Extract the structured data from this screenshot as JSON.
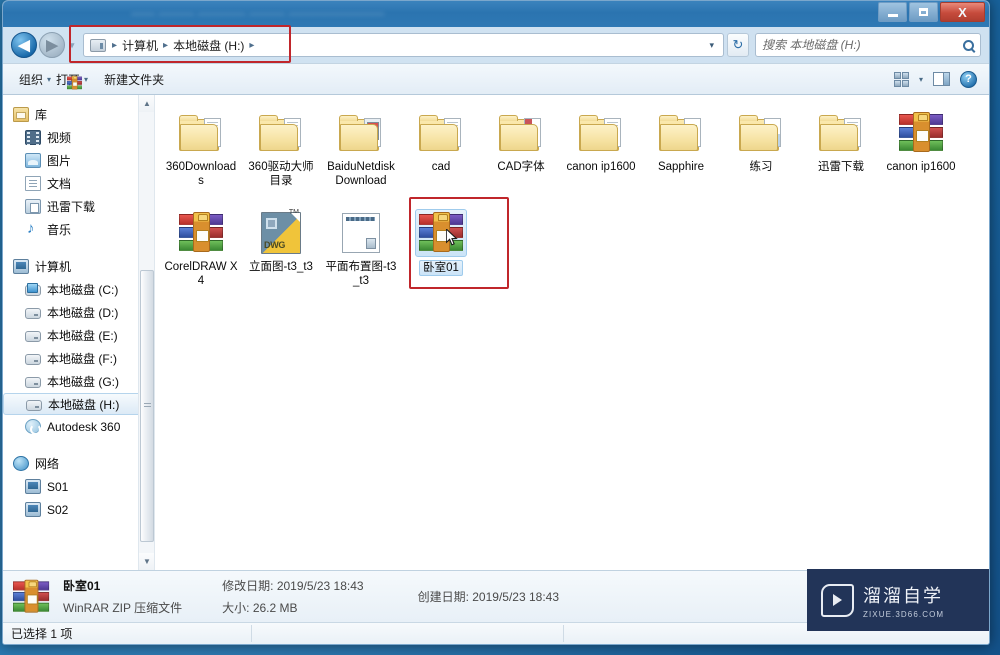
{
  "window": {
    "title_blurred": "—— ——— ———— ——— ————————",
    "controls": {
      "minimize": "—",
      "maximize": "□",
      "close": "X"
    }
  },
  "nav": {
    "back_label": "◀",
    "forward_label": "▶",
    "history_caret": "▾",
    "refresh_label": "↻",
    "address_dropdown": "▾",
    "breadcrumbs": [
      {
        "label": "计算机"
      },
      {
        "label": "本地磁盘 (H:)"
      }
    ],
    "separator": "▸"
  },
  "search": {
    "placeholder": "搜索 本地磁盘 (H:)",
    "value": ""
  },
  "toolbar": {
    "organize_label": "组织",
    "open_label": "打开",
    "new_folder_label": "新建文件夹",
    "caret": "▾",
    "help_label": "?"
  },
  "sidebar": {
    "groups": [
      {
        "root": {
          "label": "库",
          "icon": "library-icon"
        },
        "items": [
          {
            "label": "视频",
            "icon": "video-icon"
          },
          {
            "label": "图片",
            "icon": "pictures-icon"
          },
          {
            "label": "文档",
            "icon": "documents-icon"
          },
          {
            "label": "迅雷下载",
            "icon": "download-icon"
          },
          {
            "label": "音乐",
            "icon": "music-icon"
          }
        ]
      },
      {
        "root": {
          "label": "计算机",
          "icon": "computer-icon"
        },
        "items": [
          {
            "label": "本地磁盘 (C:)",
            "icon": "system-drive-icon",
            "selected": false
          },
          {
            "label": "本地磁盘 (D:)",
            "icon": "drive-icon",
            "selected": false
          },
          {
            "label": "本地磁盘 (E:)",
            "icon": "drive-icon",
            "selected": false
          },
          {
            "label": "本地磁盘 (F:)",
            "icon": "drive-icon",
            "selected": false
          },
          {
            "label": "本地磁盘 (G:)",
            "icon": "drive-icon",
            "selected": false
          },
          {
            "label": "本地磁盘 (H:)",
            "icon": "drive-icon",
            "selected": true
          },
          {
            "label": "Autodesk 360",
            "icon": "autodesk-icon",
            "selected": false
          }
        ]
      },
      {
        "root": {
          "label": "网络",
          "icon": "network-icon"
        },
        "items": [
          {
            "label": "S01",
            "icon": "computer-icon"
          },
          {
            "label": "S02",
            "icon": "computer-icon"
          }
        ]
      }
    ]
  },
  "files": [
    {
      "name": "360Downloads",
      "type": "folder"
    },
    {
      "name": "360驱动大师目录",
      "type": "folder"
    },
    {
      "name": "BaiduNetdiskDownload",
      "type": "folder-photo"
    },
    {
      "name": "cad",
      "type": "folder"
    },
    {
      "name": "CAD字体",
      "type": "folder-red"
    },
    {
      "name": "canon ip1600",
      "type": "folder"
    },
    {
      "name": "Sapphire",
      "type": "folder-green"
    },
    {
      "name": "练习",
      "type": "folder-blue"
    },
    {
      "name": "迅雷下载",
      "type": "folder"
    },
    {
      "name": "canon ip1600",
      "type": "winrar"
    },
    {
      "name": "CorelDRAW X4",
      "type": "winrar"
    },
    {
      "name": "立面图-t3_t3",
      "type": "dwg"
    },
    {
      "name": "平面布置图-t3_t3",
      "type": "document"
    },
    {
      "name": "卧室01",
      "type": "winrar",
      "selected": true
    }
  ],
  "details": {
    "file_name": "卧室01",
    "file_type": "WinRAR ZIP 压缩文件",
    "modified_label": "修改日期:",
    "modified_value": "2019/5/23 18:43",
    "size_label": "大小:",
    "size_value": "26.2 MB",
    "created_label": "创建日期:",
    "created_value": "2019/5/23 18:43"
  },
  "statusbar": {
    "text": "已选择 1 项"
  },
  "watermark": {
    "cn": "溜溜自学",
    "en": "ZIXUE.3D66.COM"
  },
  "colors": {
    "annotation_red": "#c0262b",
    "selection_blue": "#cbe4f7",
    "titlebar_blue": "#2b74b0",
    "watermark_navy": "#223458"
  }
}
